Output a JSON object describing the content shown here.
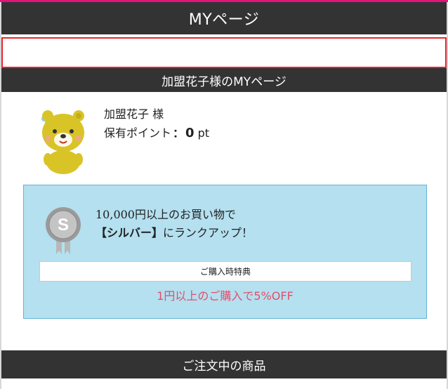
{
  "header": {
    "title": "MYページ"
  },
  "notice": {
    "text": ""
  },
  "member_section": {
    "title": "加盟花子様のMYページ"
  },
  "profile": {
    "avatar_icon": "bear-mascot-icon",
    "name": "加盟花子 様",
    "points_label": "保有ポイント",
    "points_colon": "：",
    "points_value": "0",
    "points_unit": "pt"
  },
  "rank": {
    "medal_icon": "silver-medal-icon",
    "line1": "10,000円以上のお買い物で",
    "rank_name": "【シルバー】",
    "line2_suffix": "にランクアップ！",
    "benefit_label": "ご購入時特典",
    "benefit_text": "1円以上のご購入で5%OFF"
  },
  "orders_section": {
    "title": "ご注文中の商品"
  },
  "colors": {
    "accent_stripe": "#e0147a",
    "header_bg": "#333333",
    "notice_border": "#e8252f",
    "rank_bg": "#b4e0f0",
    "benefit_text": "#e0506a"
  }
}
